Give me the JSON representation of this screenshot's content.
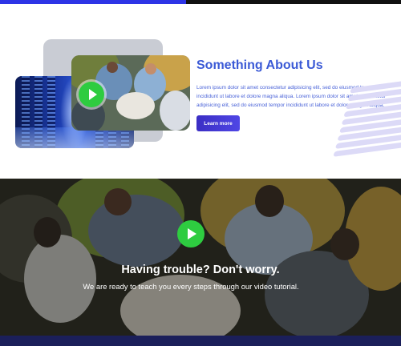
{
  "colors": {
    "accent_blue": "#2d34e6",
    "title_blue": "#3b5ad6",
    "button_purple": "#4338ca",
    "play_green": "#2ecc40",
    "brush_lavender": "#dcdaf7",
    "footer_navy": "#1b1f5a"
  },
  "icons": {
    "about_play": "play-icon",
    "video_play": "play-icon"
  },
  "about": {
    "title": "Something About Us",
    "body": "Lorem ipsum dolor sit amet consectetur adipisicing elit, sed do eiusmod tempor incididunt ut labore et dolore magna aliqua. Lorem ipsum dolor sit amet consectetur adipisicing elit, sed do eiusmod tempor incididunt ut labore et dolore magna aliqua.",
    "button_label": "Learn more"
  },
  "video": {
    "heading_normal": "Having trouble? ",
    "heading_bold": "Don't worry.",
    "subheading": "We are ready to teach you every steps through our video tutorial."
  }
}
